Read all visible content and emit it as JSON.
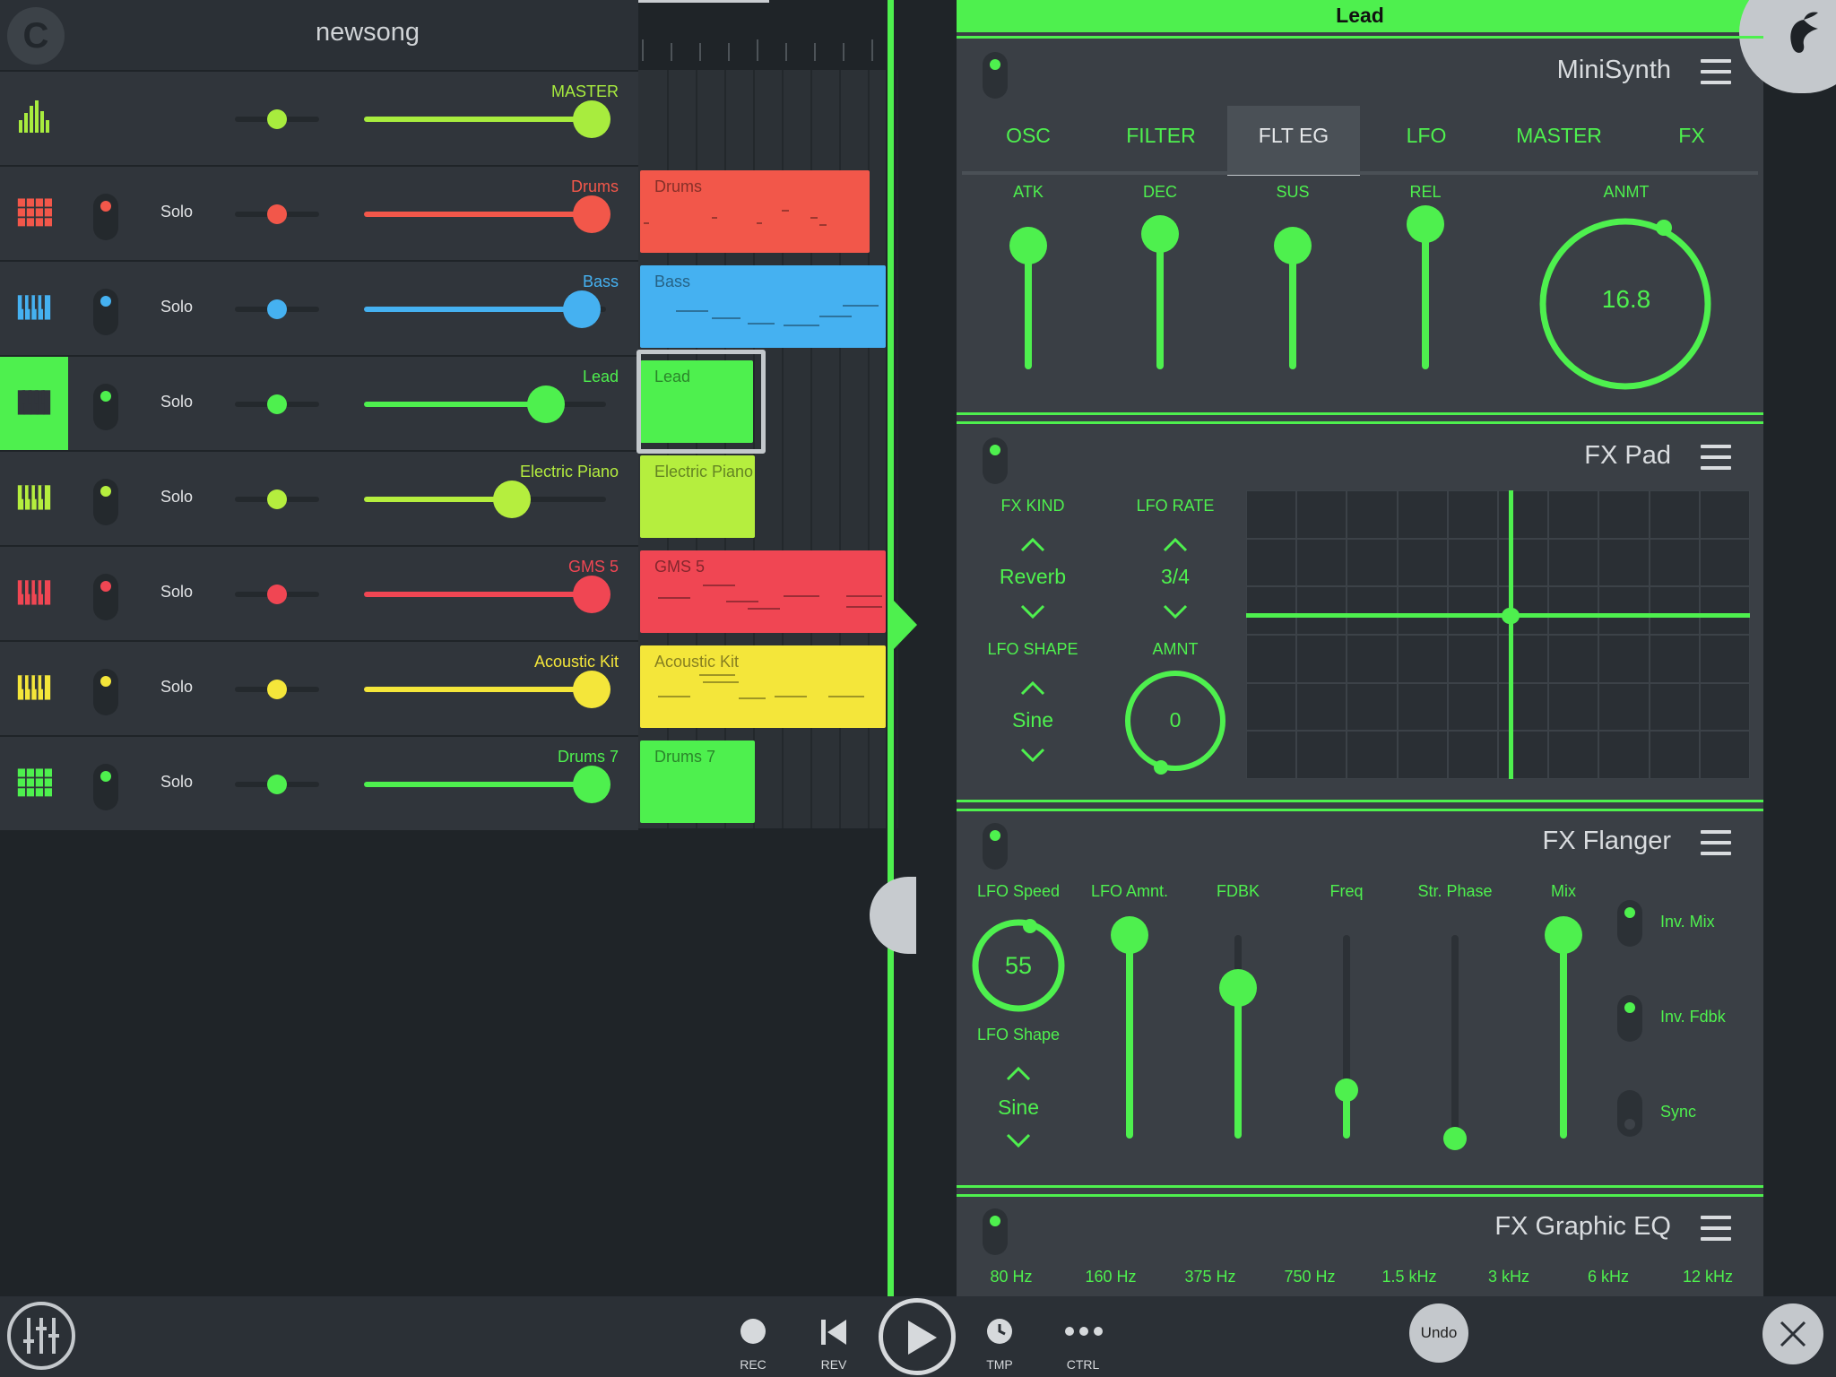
{
  "song": {
    "title": "newsong"
  },
  "tracks": [
    {
      "name": "MASTER",
      "color": "#a8ec3e",
      "solo": "",
      "pan": 0.5,
      "volume": 0.94,
      "icon": "level-meter-icon"
    },
    {
      "name": "Drums",
      "color": "#f2574a",
      "solo": "Solo",
      "pan": 0.5,
      "volume": 0.94,
      "icon": "drum-pad-icon"
    },
    {
      "name": "Bass",
      "color": "#45b1f1",
      "solo": "Solo",
      "pan": 0.5,
      "volume": 0.9,
      "icon": "piano-keys-icon"
    },
    {
      "name": "Lead",
      "color": "#4ef04e",
      "solo": "Solo",
      "pan": 0.5,
      "volume": 0.75,
      "icon": "piano-keys-icon"
    },
    {
      "name": "Electric Piano",
      "color": "#b5ee3e",
      "solo": "Solo",
      "pan": 0.5,
      "volume": 0.61,
      "icon": "piano-keys-icon"
    },
    {
      "name": "GMS 5",
      "color": "#f04653",
      "solo": "Solo",
      "pan": 0.5,
      "volume": 0.94,
      "icon": "piano-keys-icon"
    },
    {
      "name": "Acoustic Kit",
      "color": "#f4e63a",
      "solo": "Solo",
      "pan": 0.5,
      "volume": 0.94,
      "icon": "piano-keys-icon"
    },
    {
      "name": "Drums 7",
      "color": "#4ef04e",
      "solo": "Solo",
      "pan": 0.5,
      "volume": 0.94,
      "icon": "drum-pad-icon"
    }
  ],
  "clips": [
    {
      "label": "Drums",
      "color": "#f2574a"
    },
    {
      "label": "Bass",
      "color": "#45b1f1"
    },
    {
      "label": "Lead",
      "color": "#4ef04e"
    },
    {
      "label": "Electric Piano",
      "color": "#b5ee3e"
    },
    {
      "label": "GMS 5",
      "color": "#f04653"
    },
    {
      "label": "Acoustic Kit",
      "color": "#f4e63a"
    },
    {
      "label": "Drums 7",
      "color": "#4ef04e"
    }
  ],
  "panel": {
    "instrument": "Lead",
    "accent": "#4ef04e"
  },
  "minisynth": {
    "title": "MiniSynth",
    "tabs": [
      "OSC",
      "FILTER",
      "FLT EG",
      "LFO",
      "MASTER",
      "FX"
    ],
    "active_tab": "FLT EG",
    "sliders": [
      {
        "label": "ATK",
        "value": 0.8
      },
      {
        "label": "DEC",
        "value": 0.88
      },
      {
        "label": "SUS",
        "value": 0.8
      },
      {
        "label": "REL",
        "value": 0.94
      }
    ],
    "knob": {
      "label": "ANMT",
      "value": "16.8"
    }
  },
  "fxpad": {
    "title": "FX Pad",
    "fx_kind_label": "FX KIND",
    "fx_kind": "Reverb",
    "lfo_rate_label": "LFO RATE",
    "lfo_rate": "3/4",
    "lfo_shape_label": "LFO SHAPE",
    "lfo_shape": "Sine",
    "amnt_label": "AMNT",
    "amnt": "0"
  },
  "flanger": {
    "title": "FX Flanger",
    "lfo_speed_label": "LFO Speed",
    "lfo_speed": "55",
    "lfo_shape_label": "LFO Shape",
    "lfo_shape": "Sine",
    "sliders": [
      {
        "label": "LFO Amnt.",
        "value": 1.0
      },
      {
        "label": "FDBK",
        "value": 0.74
      },
      {
        "label": "Freq",
        "value": 0.24
      },
      {
        "label": "Str. Phase",
        "value": 0.0
      },
      {
        "label": "Mix",
        "value": 1.0
      }
    ],
    "toggles": [
      {
        "label": "Inv. Mix",
        "on": true
      },
      {
        "label": "Inv. Fdbk",
        "on": true
      },
      {
        "label": "Sync",
        "on": false
      }
    ]
  },
  "eq": {
    "title": "FX Graphic EQ",
    "bands": [
      "80 Hz",
      "160 Hz",
      "375 Hz",
      "750 Hz",
      "1.5 kHz",
      "3 kHz",
      "6 kHz",
      "12 kHz"
    ]
  },
  "transport": {
    "rec": "REC",
    "rev": "REV",
    "tmp": "TMP",
    "ctrl": "CTRL",
    "undo": "Undo"
  }
}
